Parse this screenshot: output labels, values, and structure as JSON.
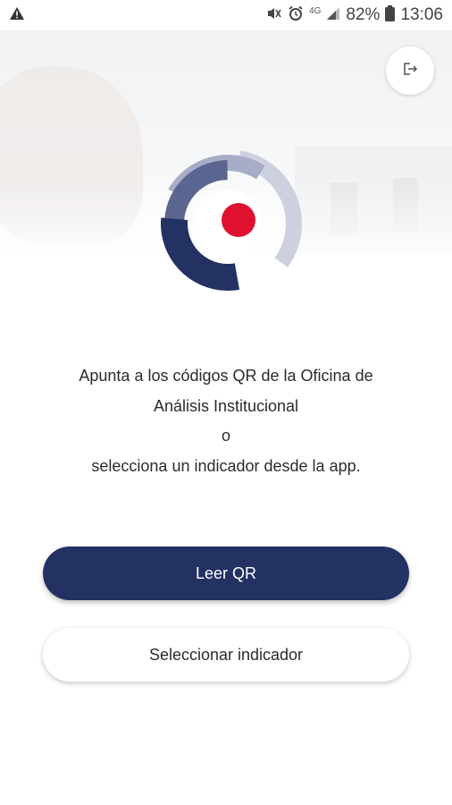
{
  "status_bar": {
    "network": "4G",
    "battery": "82%",
    "time": "13:06"
  },
  "main": {
    "message_lines": [
      "Apunta a los códigos QR de la Oficina de",
      "Análisis Institucional",
      "o",
      "selecciona un indicador desde la app."
    ]
  },
  "buttons": {
    "read_qr": "Leer QR",
    "select_indicator": "Seleccionar indicador"
  },
  "colors": {
    "primary": "#233163",
    "logo_dot": "#e0102f",
    "logo_light": "#a7adc6"
  },
  "icons": [
    "warning-icon",
    "mute-icon",
    "alarm-icon",
    "signal-icon",
    "battery-icon",
    "logout-icon"
  ]
}
